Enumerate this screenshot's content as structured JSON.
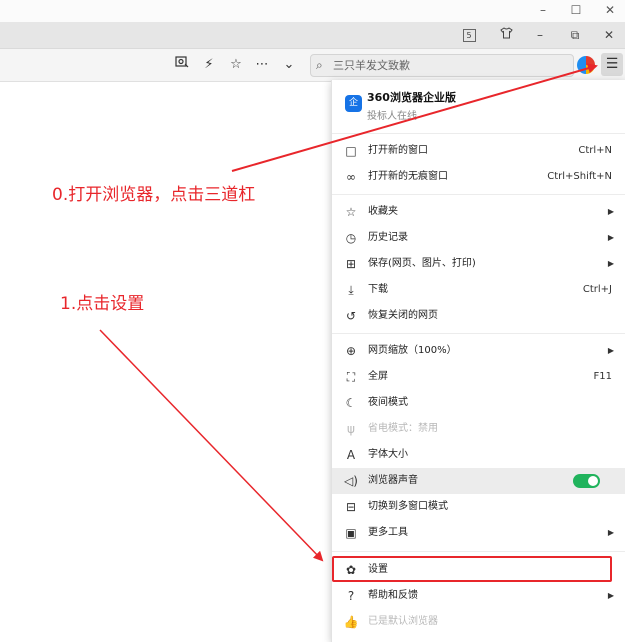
{
  "window": {
    "minimize": "–",
    "maximize": "☐",
    "close": "✕"
  },
  "tabbar": {
    "tab_count": "5",
    "shirt_icon": "shirt-icon",
    "minimize": "–",
    "restore": "⧉",
    "close": "✕"
  },
  "toolbar": {
    "icons": [
      "screenshot-icon",
      "lightning-icon",
      "star-icon",
      "more-icon",
      "chevron-down-icon"
    ],
    "search_placeholder": "三只羊发文致歉"
  },
  "menu": {
    "profile": {
      "badge": "企",
      "name": "360浏览器企业版",
      "subtitle": "投标人在线"
    },
    "items": [
      {
        "icon": "□",
        "label": "打开新的窗口",
        "shortcut": "Ctrl+N"
      },
      {
        "icon": "∞",
        "label": "打开新的无痕窗口",
        "shortcut": "Ctrl+Shift+N"
      },
      {
        "icon": "☆",
        "label": "收藏夹",
        "arrow": "▶"
      },
      {
        "icon": "◷",
        "label": "历史记录",
        "arrow": "▶"
      },
      {
        "icon": "⊞",
        "label": "保存(网页、图片、打印)",
        "arrow": "▶"
      },
      {
        "icon": "⤓",
        "label": "下载",
        "shortcut": "Ctrl+J"
      },
      {
        "icon": "↺",
        "label": "恢复关闭的网页"
      },
      {
        "icon": "⊕",
        "label": "网页缩放（100%）",
        "arrow": "▶"
      },
      {
        "icon": "⛶",
        "label": "全屏",
        "shortcut": "F11"
      },
      {
        "icon": "☾",
        "label": "夜间模式"
      },
      {
        "icon": "ψ",
        "label": "省电模式：禁用"
      },
      {
        "icon": "A",
        "label": "字体大小"
      },
      {
        "icon": "◁)",
        "label": "浏览器声音",
        "toggle_on": true
      },
      {
        "icon": "⊟",
        "label": "切换到多窗口模式"
      },
      {
        "icon": "▣",
        "label": "更多工具",
        "arrow": "▶"
      },
      {
        "icon": "✿",
        "label": "设置"
      },
      {
        "icon": "?",
        "label": "帮助和反馈",
        "arrow": "▶"
      },
      {
        "icon": "👍",
        "label": "已是默认浏览器"
      }
    ]
  },
  "annotations": {
    "step0": "0.打开浏览器，点击三道杠",
    "step1": "1.点击设置"
  },
  "colors": {
    "annotation": "#e8262b",
    "toggle_on": "#20b35c",
    "accent_badge": "#1673e6"
  }
}
